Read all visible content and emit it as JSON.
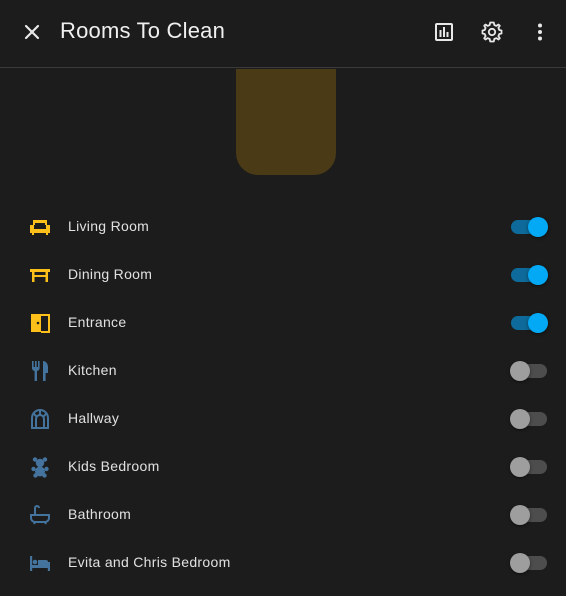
{
  "header": {
    "title": "Rooms To Clean",
    "close_icon": "close-icon",
    "history_icon": "chart-icon",
    "settings_icon": "gear-icon",
    "menu_icon": "more-vert-icon"
  },
  "colors": {
    "active_icon": "#fdbf1a",
    "inactive_icon": "#44739e",
    "switch_on": "#03a9f4",
    "preview": "#4a3b16"
  },
  "rooms": [
    {
      "label": "Living Room",
      "icon": "sofa-icon",
      "on": true
    },
    {
      "label": "Dining Room",
      "icon": "table-icon",
      "on": true
    },
    {
      "label": "Entrance",
      "icon": "door-icon",
      "on": true
    },
    {
      "label": "Kitchen",
      "icon": "silverware-icon",
      "on": false
    },
    {
      "label": "Hallway",
      "icon": "arch-window-icon",
      "on": false
    },
    {
      "label": "Kids Bedroom",
      "icon": "teddy-bear-icon",
      "on": false
    },
    {
      "label": "Bathroom",
      "icon": "bathtub-icon",
      "on": false
    },
    {
      "label": "Evita and Chris Bedroom",
      "icon": "bed-icon",
      "on": false
    }
  ]
}
